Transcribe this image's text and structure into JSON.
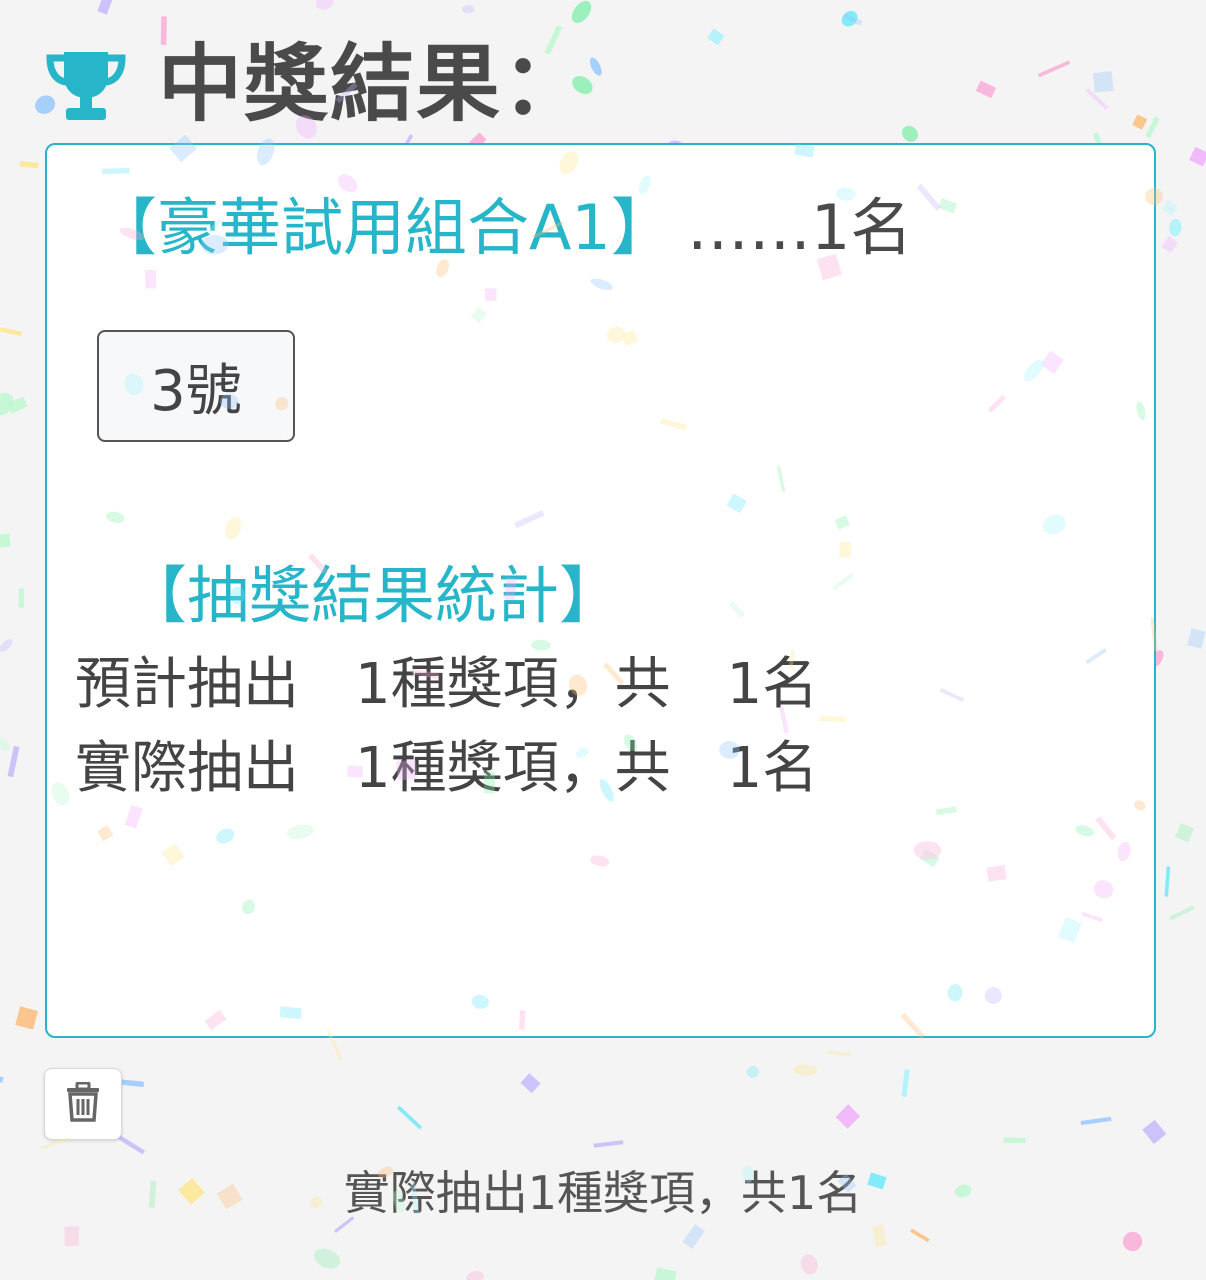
{
  "header": {
    "title": "中獎結果：",
    "icon": "trophy-icon",
    "accent_color": "#26b5c9"
  },
  "prize": {
    "name": "【豪華試用組合A1】",
    "count_label": "……1名"
  },
  "winners": [
    {
      "label": "3號"
    }
  ],
  "stats": {
    "heading": "【抽獎結果統計】",
    "planned": "預計抽出　1種獎項，共　1名",
    "actual": "實際抽出　1種獎項，共　1名"
  },
  "toolbar": {
    "delete_icon": "trash-icon"
  },
  "footer": {
    "summary": "實際抽出1種獎項，共1名"
  },
  "confetti_colors": [
    "#f9a8d4",
    "#93c5fd",
    "#86efac",
    "#fde68a",
    "#c4b5fd",
    "#fdba74",
    "#67e8f9",
    "#f0abfc",
    "#a5f3fc",
    "#bbf7d0"
  ]
}
